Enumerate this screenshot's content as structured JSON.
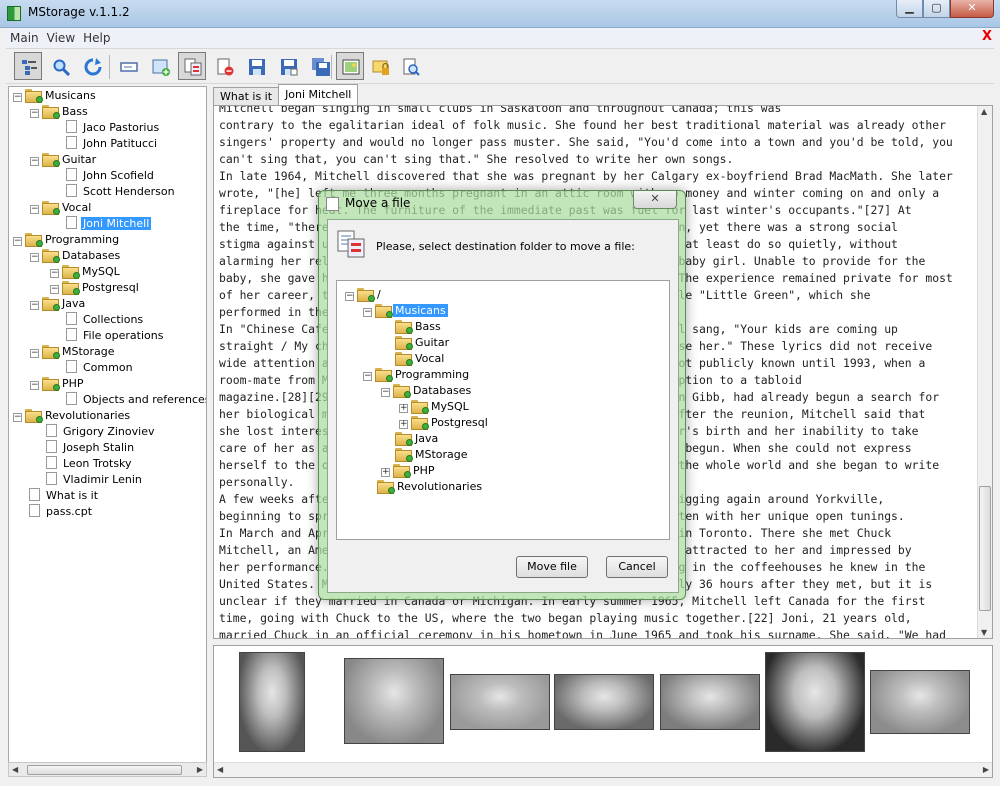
{
  "window": {
    "title": "MStorage v.1.1.2",
    "minimize": "▁",
    "maximize": "▢",
    "close": "✕"
  },
  "menu": {
    "items": [
      "Main",
      "View",
      "Help"
    ],
    "close": "X"
  },
  "toolbar": {
    "buttons": [
      {
        "icon": "tree-view-icon",
        "pressed": true
      },
      {
        "icon": "search-icon"
      },
      {
        "icon": "refresh-icon"
      },
      {
        "icon": "rename-icon"
      },
      {
        "icon": "add-folder-icon"
      },
      {
        "icon": "move-file-icon",
        "pressed": true
      },
      {
        "icon": "delete-file-icon"
      },
      {
        "icon": "save-icon"
      },
      {
        "icon": "save-as-icon"
      },
      {
        "icon": "save-all-icon"
      },
      {
        "icon": "image-icon",
        "pressed": true
      },
      {
        "icon": "lock-folder-icon"
      },
      {
        "icon": "preview-icon"
      }
    ]
  },
  "tree": {
    "items": [
      {
        "label": "Musicans",
        "type": "folder",
        "level": 0,
        "expanded": true
      },
      {
        "label": "Bass",
        "type": "folder",
        "level": 1,
        "expanded": true
      },
      {
        "label": "Jaco Pastorius",
        "type": "file",
        "level": 2
      },
      {
        "label": "John Patitucci",
        "type": "file",
        "level": 2
      },
      {
        "label": "Guitar",
        "type": "folder",
        "level": 1,
        "expanded": true
      },
      {
        "label": "John Scofield",
        "type": "file",
        "level": 2
      },
      {
        "label": "Scott Henderson",
        "type": "file",
        "level": 2
      },
      {
        "label": "Vocal",
        "type": "folder",
        "level": 1,
        "expanded": true
      },
      {
        "label": "Joni Mitchell",
        "type": "file",
        "level": 2,
        "selected": true
      },
      {
        "label": "Programming",
        "type": "folder",
        "level": 0,
        "expanded": true
      },
      {
        "label": "Databases",
        "type": "folder",
        "level": 1,
        "expanded": true
      },
      {
        "label": "MySQL",
        "type": "folder",
        "level": 2
      },
      {
        "label": "Postgresql",
        "type": "folder",
        "level": 2
      },
      {
        "label": "Java",
        "type": "folder",
        "level": 1,
        "expanded": true
      },
      {
        "label": "Collections",
        "type": "file",
        "level": 2
      },
      {
        "label": "File operations",
        "type": "file",
        "level": 2
      },
      {
        "label": "MStorage",
        "type": "folder",
        "level": 1,
        "expanded": true
      },
      {
        "label": "Common",
        "type": "file",
        "level": 2
      },
      {
        "label": "PHP",
        "type": "folder",
        "level": 1,
        "expanded": true
      },
      {
        "label": "Objects and references",
        "type": "file",
        "level": 2
      },
      {
        "label": "Revolutionaries",
        "type": "folder",
        "level": 0,
        "expanded": true
      },
      {
        "label": "Grigory Zinoviev",
        "type": "file",
        "level": 1
      },
      {
        "label": "Joseph Stalin",
        "type": "file",
        "level": 1
      },
      {
        "label": "Leon Trotsky",
        "type": "file",
        "level": 1
      },
      {
        "label": "Vladimir Lenin",
        "type": "file",
        "level": 1
      },
      {
        "label": "What is it",
        "type": "file",
        "level": 0
      },
      {
        "label": "pass.cpt",
        "type": "file",
        "level": 0
      }
    ]
  },
  "tabs": [
    {
      "label": "What is it",
      "active": false
    },
    {
      "label": "Joni Mitchell",
      "active": true
    }
  ],
  "article": {
    "text": "Mitchell began singing in small clubs in Saskatoon and throughout Canada; this was\ncontrary to the egalitarian ideal of folk music. She found her best traditional material was already other\nsingers' property and would no longer pass muster. She said, \"You'd come into a town and you'd be told, you\ncan't sing that, you can't sing that.\" She resolved to write her own songs.\nIn late 1964, Mitchell discovered that she was pregnant by her Calgary ex-boyfriend Brad MacMath. She later\nwrote, \"[he] left me three months pregnant in an attic room with no money and winter coming on and only a\nfireplace for heat. The furniture of the immediate past was fuel for last winter's occupants.\"[27] At\nthe time, \"there was no word of abortion, and adoption was an option, yet there was a strong social\nstigma against unwed mothers\". If one had to give birth, one should at least do so quietly, without\nalarming her relatives. In February 1965, Mitchell gave birth to a baby girl. Unable to provide for the\nbaby, she gave her daughter up for adoption in the summer of 1965. The experience remained private for most\nof her career, though she wrote songs that alluded to it, for example \"Little Green\", which she\nperformed in the 1960s but did not record until 1971's album Blue.\nIn \"Chinese Cafe\" from her 1982 album Wild Things Run Fast, Mitchell sang, \"Your kids are coming up\nstraight / My child's a stranger / I bore her / But I could not raise her.\" These lyrics did not receive\nwide attention at the time, and the existence of the daughter was not publicly known until 1993, when a\nroom-mate from Mitchell's art school days sold the story of the adoption to a tabloid\nmagazine.[28][29] Mitchell's daughter, who had been renamed Kilauren Gibb, had already begun a search for\nher biological mother, and in 1997 the two were reunited.[29][30] After the reunion, Mitchell said that\nshe lost interest in writing songs. She said that since her daughter's birth and her inability to take\ncare of her as a mother, her career as a songwriter had effectively begun. When she could not express\nherself to the one person she wanted to, she turned outward toward the whole world and she began to write\npersonally.\nA few weeks after the birth of her daughter in 1965, Mitchell was gigging again around Yorkville,\nbeginning to spread her reputation by performing songs she had written with her unique open tunings.\nIn March and April 1965 she played at the Penny Farthing folk club in Toronto. There she met Chuck\nMitchell, an American folk singer who was immediately and intensely attracted to her and impressed by\nher performance. He told her that she could easily find work singing in the coffeehouses he knew in the\nUnited States. Mitchell agreed to go with him. They were married only 36 hours after they met, but it is\nunclear if they married in Canada or Michigan. In early summer 1965, Mitchell left Canada for the first\ntime, going with Chuck to the US, where the two began playing music together.[22] Joni, 21 years old,\nmarried Chuck in an official ceremony in his hometown in June 1965 and took his surname. She said, \"We had"
  },
  "dialog": {
    "title": "Move a file",
    "close": "✕",
    "message": "Please, select destination folder to move a file:",
    "tree": [
      {
        "label": "/",
        "level": 0,
        "expander": "−"
      },
      {
        "label": "Musicans",
        "level": 1,
        "expander": "−",
        "selected": true
      },
      {
        "label": "Bass",
        "level": 2
      },
      {
        "label": "Guitar",
        "level": 2
      },
      {
        "label": "Vocal",
        "level": 2
      },
      {
        "label": "Programming",
        "level": 1,
        "expander": "−"
      },
      {
        "label": "Databases",
        "level": 2,
        "expander": "−"
      },
      {
        "label": "MySQL",
        "level": 3,
        "expander": "+"
      },
      {
        "label": "Postgresql",
        "level": 3,
        "expander": "+"
      },
      {
        "label": "Java",
        "level": 2
      },
      {
        "label": "MStorage",
        "level": 2
      },
      {
        "label": "PHP",
        "level": 2,
        "expander": "+"
      },
      {
        "label": "Revolutionaries",
        "level": 1
      }
    ],
    "move_label": "Move file",
    "cancel_label": "Cancel"
  },
  "gallery": {
    "photos": [
      {
        "name": "photo-1"
      },
      {
        "name": "photo-2"
      },
      {
        "name": "photo-3"
      },
      {
        "name": "photo-4"
      },
      {
        "name": "photo-5"
      },
      {
        "name": "photo-6"
      },
      {
        "name": "photo-7"
      }
    ]
  },
  "colors": {
    "selection": "#3399ff",
    "dialog_frame": "#aadca0",
    "titlebar": "#b8d0ec"
  }
}
